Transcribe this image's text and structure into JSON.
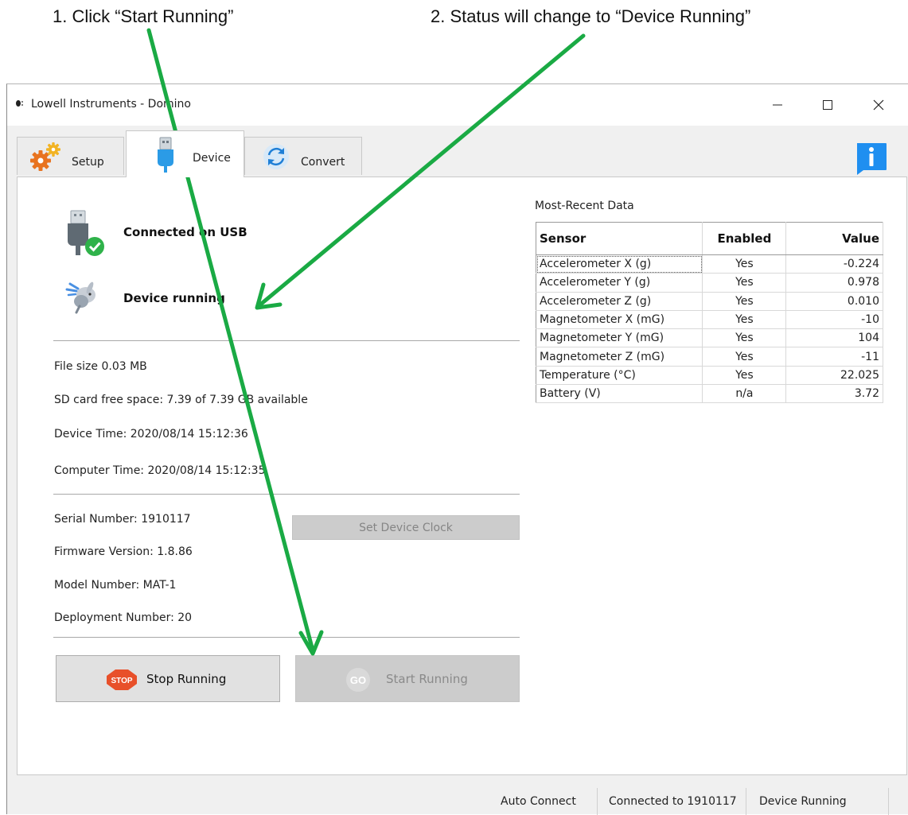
{
  "annotations": {
    "step1": "1. Click “Start Running”",
    "step2": "2. Status will change to “Device Running”"
  },
  "window": {
    "title": "Lowell Instruments - Domino",
    "controls": {
      "minimize": "—",
      "maximize": "☐",
      "close": "✕"
    }
  },
  "tabs": [
    {
      "label": "Setup",
      "icon": "gears-icon",
      "active": false
    },
    {
      "label": "Device",
      "icon": "usb-icon",
      "active": true
    },
    {
      "label": "Convert",
      "icon": "convert-icon",
      "active": false
    }
  ],
  "device": {
    "connection_status": "Connected on USB",
    "run_status": "Device running",
    "file_size": "File size 0.03 MB",
    "sd_card": "SD card free space: 7.39 of 7.39 GB available",
    "device_time": "Device Time: 2020/08/14 15:12:36",
    "set_clock_label": "Set Device Clock",
    "computer_time": "Computer Time: 2020/08/14 15:12:35",
    "serial_number": "Serial Number: 1910117",
    "firmware_version": "Firmware Version: 1.8.86",
    "model_number": "Model Number: MAT-1",
    "deployment_number": "Deployment Number: 20",
    "stop_label": "Stop Running",
    "stop_icon_text": "STOP",
    "start_label": "Start Running",
    "start_icon_text": "GO"
  },
  "recent_data": {
    "title": "Most-Recent Data",
    "headers": [
      "Sensor",
      "Enabled",
      "Value"
    ],
    "rows": [
      [
        "Accelerometer X (g)",
        "Yes",
        "-0.224"
      ],
      [
        "Accelerometer Y (g)",
        "Yes",
        "0.978"
      ],
      [
        "Accelerometer Z (g)",
        "Yes",
        "0.010"
      ],
      [
        "Magnetometer X (mG)",
        "Yes",
        "-10"
      ],
      [
        "Magnetometer Y (mG)",
        "Yes",
        "104"
      ],
      [
        "Magnetometer Z (mG)",
        "Yes",
        "-11"
      ],
      [
        "Temperature (°C)",
        "Yes",
        "22.025"
      ],
      [
        "Battery (V)",
        "n/a",
        "3.72"
      ]
    ]
  },
  "statusbar": {
    "auto_connect": "Auto Connect",
    "connected_to": "Connected to 1910117",
    "device_state": "Device Running"
  },
  "colors": {
    "arrow": "#1aaa44",
    "stop_sign": "#e8502a",
    "info_blue": "#1f8ff0",
    "usb_blue": "#2b9be6"
  }
}
